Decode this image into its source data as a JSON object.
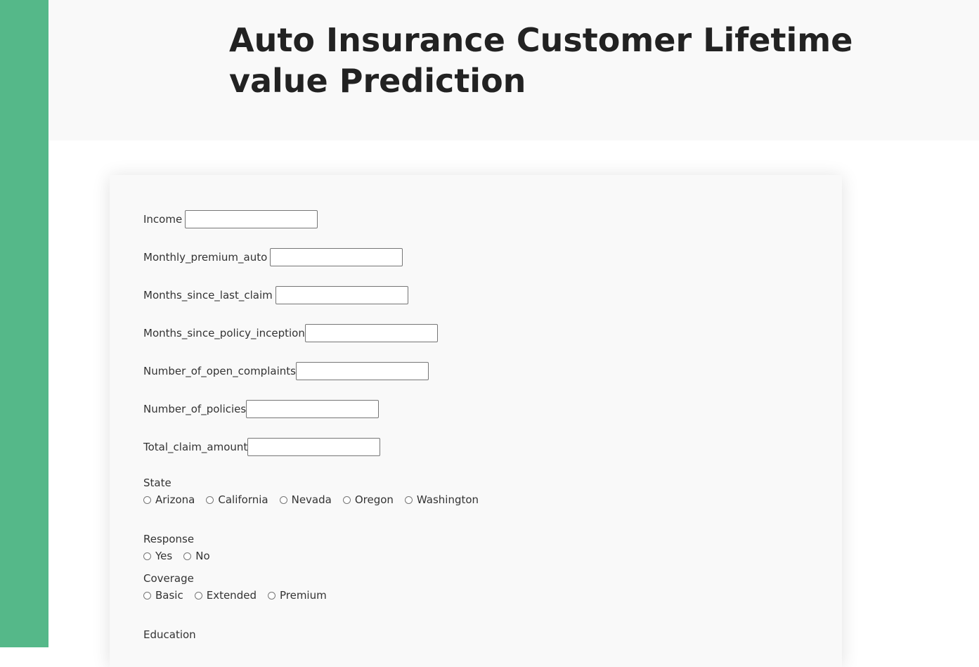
{
  "header": {
    "title": "Auto Insurance Customer Lifetime value Prediction"
  },
  "form": {
    "fields": [
      {
        "label": "Income",
        "value": ""
      },
      {
        "label": "Monthly_premium_auto",
        "value": ""
      },
      {
        "label": "Months_since_last_claim",
        "value": ""
      },
      {
        "label": "Months_since_policy_inception",
        "value": ""
      },
      {
        "label": "Number_of_open_complaints",
        "value": ""
      },
      {
        "label": "Number_of_policies",
        "value": ""
      },
      {
        "label": "Total_claim_amount",
        "value": ""
      }
    ],
    "state": {
      "label": "State",
      "options": [
        "Arizona",
        "California",
        "Nevada",
        "Oregon",
        "Washington"
      ]
    },
    "response": {
      "label": "Response",
      "options": [
        "Yes",
        "No"
      ]
    },
    "coverage": {
      "label": "Coverage",
      "options": [
        "Basic",
        "Extended",
        "Premium"
      ]
    },
    "education": {
      "label": "Education"
    }
  },
  "colors": {
    "sidebar": "#55b889",
    "header_bg": "#f9f9f9",
    "card_bg": "#f9f9f9"
  }
}
